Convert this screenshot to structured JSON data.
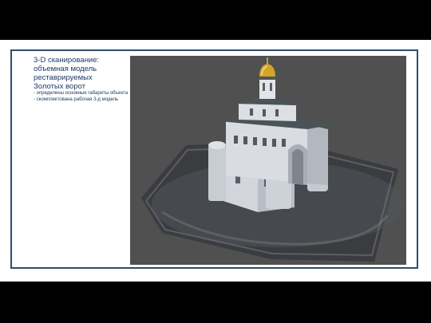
{
  "slide": {
    "title": "3-D сканирование:\nобъемная модель реставрируемых\nЗолотых ворот",
    "bullets": [
      "- определены основные габариты объекта",
      "- скомплектована рабочая 3-д модель"
    ]
  },
  "image": {
    "subject": "golden-gate-3d-scan-model"
  },
  "colors": {
    "frame": "#2e4d6b",
    "text": "#1e3a66",
    "viewport_bg": "#505050",
    "dome": "#d4a52a"
  }
}
